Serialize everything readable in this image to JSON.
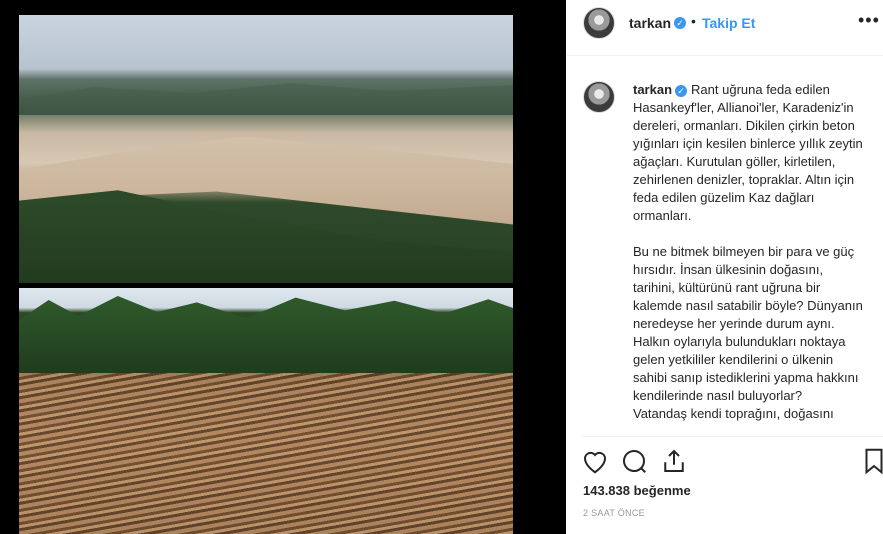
{
  "post": {
    "username": "tarkan",
    "verified_mark": "✓",
    "separator": "•",
    "follow_label": "Takip Et",
    "more_label": "•••",
    "caption_paragraphs": [
      "Rant uğruna feda edilen Hasankeyf'ler, Allianoi'ler, Karadeniz'in dereleri, ormanları. Dikilen çirkin beton yığınları için kesilen binlerce yıllık zeytin ağaçları. Kurutulan göller, kirletilen, zehirlenen denizler, topraklar. Altın için feda edilen güzelim Kaz dağları ormanları.",
      "Bu ne bitmek bilmeyen bir para ve güç hırsıdır. İnsan ülkesinin doğasını, tarihini, kültürünü rant uğruna bir kalemde nasıl satabilir böyle? Dünyanın neredeyse her yerinde durum aynı.",
      "Halkın oylarıyla bulundukları noktaya gelen yetkililer kendilerini o ülkenin sahibi sanıp istediklerini yapma hakkını kendilerinde nasıl buluyorlar?",
      "Vatandaş kendi toprağını, doğasını"
    ],
    "likes_text": "143.838 beğenme",
    "timestamp": "2 SAAT ÖNCE"
  },
  "icons": {
    "like": "heart-icon",
    "comment": "comment-icon",
    "share": "share-icon",
    "save": "bookmark-icon"
  },
  "colors": {
    "accent": "#3897f0",
    "text": "#262626",
    "muted": "#999999"
  }
}
